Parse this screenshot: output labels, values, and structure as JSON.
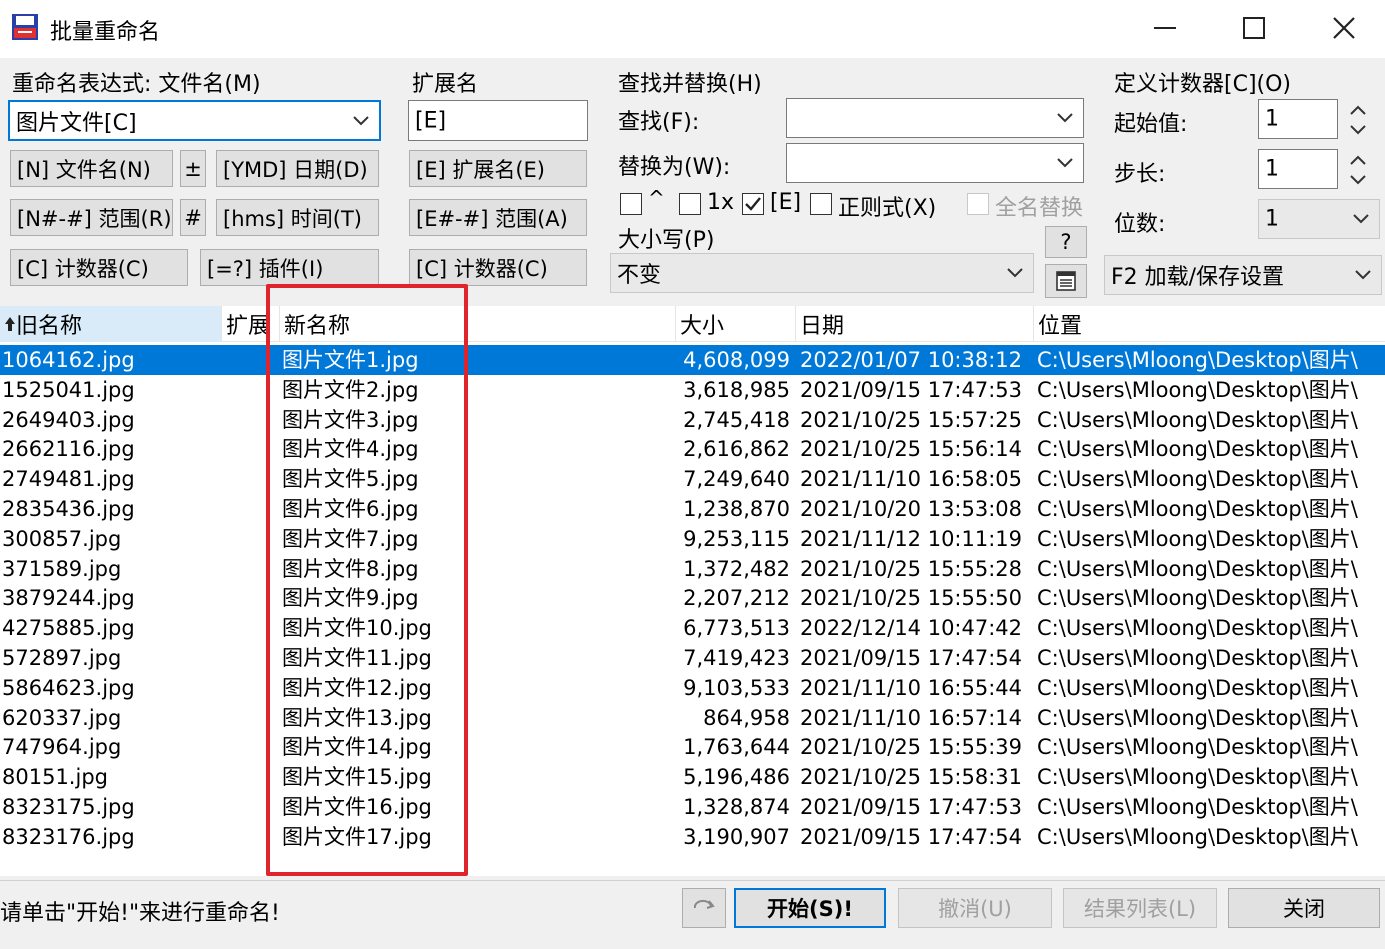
{
  "window": {
    "title": "批量重命名",
    "controls": {
      "minimize": "minimize-icon",
      "maximize": "maximize-icon",
      "close": "close-icon"
    }
  },
  "rename_mask": {
    "label": "重命名表达式: 文件名(M)",
    "value": "图片文件[C]",
    "buttons": {
      "name": "[N] 文件名(N)",
      "plusminus": "±",
      "date": "[YMD] 日期(D)",
      "range": "[N#-#] 范围(R)",
      "hash": "#",
      "time": "[hms] 时间(T)",
      "counter": "[C] 计数器(C)",
      "plugin": "[=?] 插件(I)"
    }
  },
  "extension": {
    "label": "扩展名",
    "value": "[E]",
    "buttons": {
      "ext": "[E] 扩展名(E)",
      "range": "[E#-#] 范围(A)",
      "counter": "[C] 计数器(C)"
    }
  },
  "search_replace": {
    "label": "查找并替换(H)",
    "search_label": "查找(F):",
    "search_value": "",
    "replace_label": "替换为(W):",
    "replace_value": "",
    "options": {
      "caret_label": "^",
      "once_label": "1x",
      "ext_label": "[E]",
      "regex_label": "正则式(X)",
      "replace_all_label": "全名替换"
    },
    "case_label": "大小写(P)",
    "case_value": "不变",
    "help_label": "?"
  },
  "counter": {
    "label": "定义计数器[C](O)",
    "start_label": "起始值:",
    "start_value": "1",
    "step_label": "步长:",
    "step_value": "1",
    "digits_label": "位数:",
    "digits_value": "1",
    "settings_value": "F2 加载/保存设置"
  },
  "list": {
    "columns": {
      "old": "旧名称",
      "ext": "扩展",
      "new": "新名称",
      "size": "大小",
      "date": "日期",
      "location": "位置"
    },
    "rows": [
      {
        "old": "1064162.jpg",
        "new": "图片文件1.jpg",
        "size": "4,608,099",
        "date": "2022/01/07 10:38:12",
        "location": "C:\\Users\\Mloong\\Desktop\\图片\\"
      },
      {
        "old": "1525041.jpg",
        "new": "图片文件2.jpg",
        "size": "3,618,985",
        "date": "2021/09/15 17:47:53",
        "location": "C:\\Users\\Mloong\\Desktop\\图片\\"
      },
      {
        "old": "2649403.jpg",
        "new": "图片文件3.jpg",
        "size": "2,745,418",
        "date": "2021/10/25 15:57:25",
        "location": "C:\\Users\\Mloong\\Desktop\\图片\\"
      },
      {
        "old": "2662116.jpg",
        "new": "图片文件4.jpg",
        "size": "2,616,862",
        "date": "2021/10/25 15:56:14",
        "location": "C:\\Users\\Mloong\\Desktop\\图片\\"
      },
      {
        "old": "2749481.jpg",
        "new": "图片文件5.jpg",
        "size": "7,249,640",
        "date": "2021/11/10 16:58:05",
        "location": "C:\\Users\\Mloong\\Desktop\\图片\\"
      },
      {
        "old": "2835436.jpg",
        "new": "图片文件6.jpg",
        "size": "1,238,870",
        "date": "2021/10/20 13:53:08",
        "location": "C:\\Users\\Mloong\\Desktop\\图片\\"
      },
      {
        "old": "300857.jpg",
        "new": "图片文件7.jpg",
        "size": "9,253,115",
        "date": "2021/11/12 10:11:19",
        "location": "C:\\Users\\Mloong\\Desktop\\图片\\"
      },
      {
        "old": "371589.jpg",
        "new": "图片文件8.jpg",
        "size": "1,372,482",
        "date": "2021/10/25 15:55:28",
        "location": "C:\\Users\\Mloong\\Desktop\\图片\\"
      },
      {
        "old": "3879244.jpg",
        "new": "图片文件9.jpg",
        "size": "2,207,212",
        "date": "2021/10/25 15:55:50",
        "location": "C:\\Users\\Mloong\\Desktop\\图片\\"
      },
      {
        "old": "4275885.jpg",
        "new": "图片文件10.jpg",
        "size": "6,773,513",
        "date": "2022/12/14 10:47:42",
        "location": "C:\\Users\\Mloong\\Desktop\\图片\\"
      },
      {
        "old": "572897.jpg",
        "new": "图片文件11.jpg",
        "size": "7,419,423",
        "date": "2021/09/15 17:47:54",
        "location": "C:\\Users\\Mloong\\Desktop\\图片\\"
      },
      {
        "old": "5864623.jpg",
        "new": "图片文件12.jpg",
        "size": "9,103,533",
        "date": "2021/11/10 16:55:44",
        "location": "C:\\Users\\Mloong\\Desktop\\图片\\"
      },
      {
        "old": "620337.jpg",
        "new": "图片文件13.jpg",
        "size": "864,958",
        "date": "2021/11/10 16:57:14",
        "location": "C:\\Users\\Mloong\\Desktop\\图片\\"
      },
      {
        "old": "747964.jpg",
        "new": "图片文件14.jpg",
        "size": "1,763,644",
        "date": "2021/10/25 15:55:39",
        "location": "C:\\Users\\Mloong\\Desktop\\图片\\"
      },
      {
        "old": "80151.jpg",
        "new": "图片文件15.jpg",
        "size": "5,196,486",
        "date": "2021/10/25 15:58:31",
        "location": "C:\\Users\\Mloong\\Desktop\\图片\\"
      },
      {
        "old": "8323175.jpg",
        "new": "图片文件16.jpg",
        "size": "1,328,874",
        "date": "2021/09/15 17:47:53",
        "location": "C:\\Users\\Mloong\\Desktop\\图片\\"
      },
      {
        "old": "8323176.jpg",
        "new": "图片文件17.jpg",
        "size": "3,190,907",
        "date": "2021/09/15 17:47:54",
        "location": "C:\\Users\\Mloong\\Desktop\\图片\\"
      }
    ]
  },
  "status": {
    "text": "请单击\"开始!\"来进行重命名!",
    "start_label": "开始(S)!",
    "undo_label": "撤消(U)",
    "result_label": "结果列表(L)",
    "close_label": "关闭"
  },
  "colors": {
    "accent": "#0078d7",
    "highlight": "#e0242c",
    "disabled": "#a0a0a0"
  }
}
